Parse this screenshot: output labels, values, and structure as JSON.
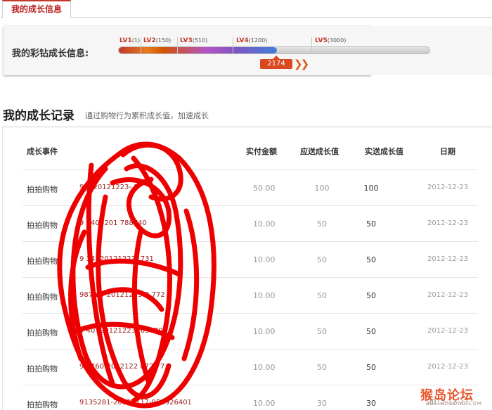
{
  "tab": {
    "label": "我的成长信息"
  },
  "growth": {
    "label": "我的彩钻成长信息:",
    "levels": [
      {
        "name": "LV1",
        "threshold": "(1)"
      },
      {
        "name": "LV2",
        "threshold": "(150)"
      },
      {
        "name": "LV3",
        "threshold": "(510)"
      },
      {
        "name": "LV4",
        "threshold": "(1200)"
      },
      {
        "name": "LV5",
        "threshold": "(3000)"
      }
    ],
    "current_value": "2174",
    "progress_fraction": 0.51
  },
  "records": {
    "title": "我的成长记录",
    "subtitle": "通过购物行为累积成长值，加速成长",
    "headers": {
      "event": "成长事件",
      "paid": "实付金额",
      "due": "应送成长值",
      "real": "实送成长值",
      "date": "日期"
    },
    "rows": [
      {
        "event": "拍拍购物",
        "order": "91        -20121223-   8      ",
        "paid": "50.00",
        "due": "100",
        "real": "100",
        "date": "2012-12-23"
      },
      {
        "event": "拍拍购物",
        "order": "9    340     -201          788740",
        "paid": "10.00",
        "due": "50",
        "real": "50",
        "date": "2012-12-23"
      },
      {
        "event": "拍拍购物",
        "order": "9    34    -20121223-      731",
        "paid": "10.00",
        "due": "50",
        "real": "50",
        "date": "2012-12-23"
      },
      {
        "event": "拍拍购物",
        "order": "9873      0-20121223-9    772",
        "paid": "10.00",
        "due": "50",
        "real": "50",
        "date": "2012-12-23"
      },
      {
        "event": "拍拍购物",
        "order": "9     40    -20121223-    69070",
        "paid": "10.00",
        "due": "50",
        "real": "50",
        "date": "2012-12-23"
      },
      {
        "event": "拍拍购物",
        "order": "9    0760-2012122    8728   7",
        "paid": "10.00",
        "due": "50",
        "real": "50",
        "date": "2012-12-23"
      },
      {
        "event": "拍拍购物",
        "order": "9135281-20121117-953926401",
        "paid": "10.00",
        "due": "30",
        "real": "30",
        "date": "2012-12-23"
      }
    ]
  },
  "watermark": {
    "main": "猴岛论坛",
    "sub": "BBS.HOUDAO.COM"
  },
  "colors": {
    "accent": "#c0392b",
    "badge": "#d9481e",
    "order_link": "#9b1c1c",
    "scribble": "#ee0000"
  }
}
